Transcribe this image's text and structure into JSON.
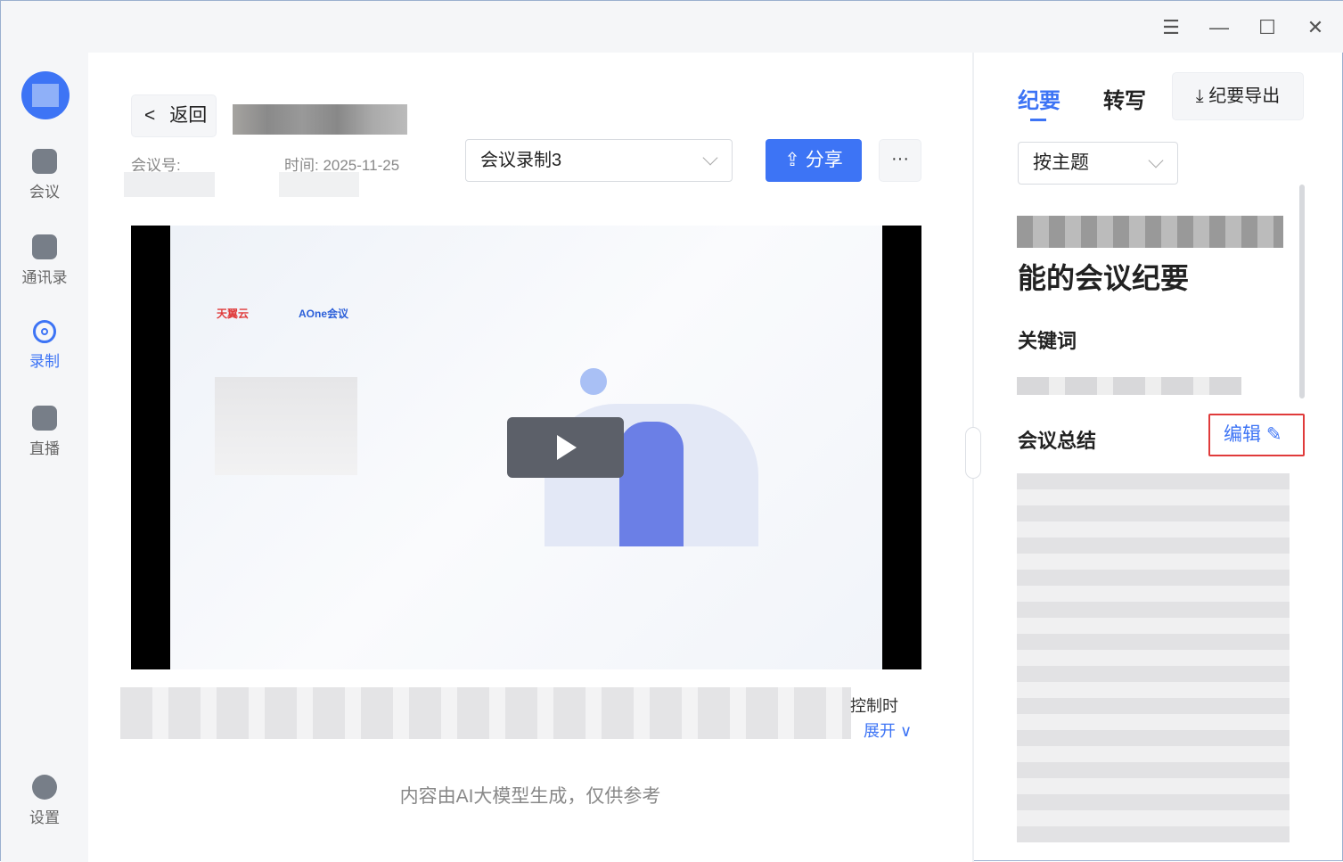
{
  "window": {
    "menu_icon": "☰",
    "minimize_icon": "—",
    "maximize_icon": "☐",
    "close_icon": "✕"
  },
  "sidebar": {
    "items": [
      {
        "label": "会议"
      },
      {
        "label": "通讯录"
      },
      {
        "label": "录制"
      },
      {
        "label": "直播"
      },
      {
        "label": "设置"
      }
    ],
    "active": "录制"
  },
  "header": {
    "back_label": "返回",
    "meeting_no_label": "会议号:",
    "time_label": "时间: 2025-11-25",
    "recording_select": "会议录制3",
    "share_label": "分享",
    "more_label": "···"
  },
  "video": {
    "brand1": "天翼云",
    "brand2": "AOne会议"
  },
  "description": {
    "tail_text": "控制时",
    "expand_label": "展开"
  },
  "disclaimer": "内容由AI大模型生成，仅供参考",
  "right_panel": {
    "tabs": [
      {
        "label": "纪要"
      },
      {
        "label": "转写"
      }
    ],
    "export_label": "纪要导出",
    "group_select": "按主题",
    "title_tail": "能的会议纪要",
    "keywords_heading": "关键词",
    "summary_heading": "会议总结",
    "edit_label": "编辑"
  },
  "colors": {
    "accent": "#3d74f5",
    "highlight": "#e03b3b"
  }
}
